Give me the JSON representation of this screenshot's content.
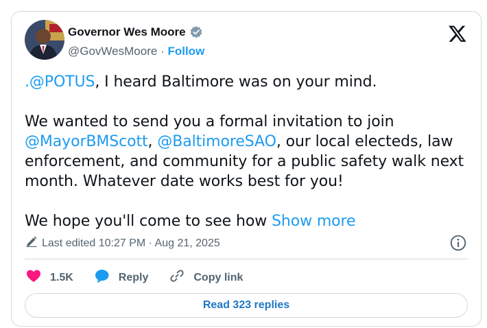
{
  "author": {
    "name": "Governor Wes Moore",
    "handle": "@GovWesMoore",
    "separator": "·",
    "follow_label": "Follow"
  },
  "tweet": {
    "line1_mention": ".@POTUS",
    "line1_rest": ", I heard Baltimore was on your mind.",
    "p2_start": "We wanted to send you a formal invitation to join ",
    "p2_mention1": "@MayorBMScott",
    "p2_comma": ", ",
    "p2_mention2": "@BaltimoreSAO",
    "p2_rest": ", our local electeds, law enforcement, and community for a public safety walk next month. Whatever date works best for you!",
    "p3_text": "We hope you'll come to see how ",
    "show_more": "Show more"
  },
  "meta": {
    "edited_label": "Last edited 10:27 PM · Aug 21, 2025"
  },
  "actions": {
    "like_count": "1.5K",
    "reply_label": "Reply",
    "copy_label": "Copy link"
  },
  "footer": {
    "read_replies_label": "Read 323 replies"
  },
  "colors": {
    "accent": "#1d9bf0",
    "like": "#f91880",
    "muted": "#536471"
  }
}
